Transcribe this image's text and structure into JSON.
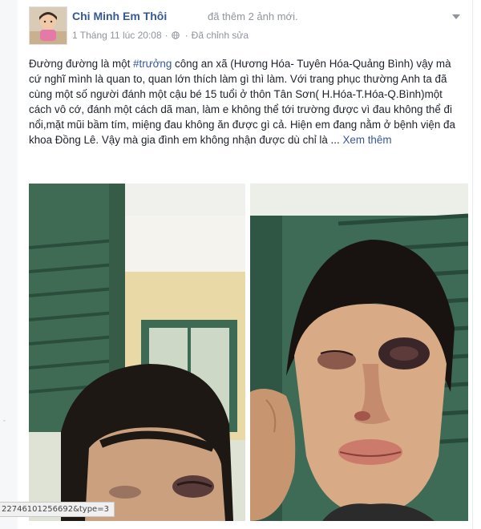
{
  "post": {
    "author": "Chi Minh Em Thôi",
    "action": "đã thêm 2 ảnh mới.",
    "timestamp": "1 Tháng 11 lúc 20:08",
    "separator": "·",
    "edited": "Đã chỉnh sửa",
    "privacy_icon": "globe-icon",
    "menu_icon": "chevron-down-icon",
    "text_before_tag": "Đường đường là một ",
    "hashtag": "#trưởng",
    "text_after_tag": " công an xã (Hương Hóa- Tuyên Hóa-Quảng Bình) vậy mà cứ nghĩ mình là quan to, quan lớn thích làm gì thì làm. Với trang phục thường Anh ta đã cùng một số người đánh một cậu bé 15 tuổi ở thôn Tân Sơn( H.Hóa-T.Hóa-Q.Bình)một cách vô cớ, đánh một cách dã man, làm e không thể tới trường được vì đau không thể đi nổi,mặt mũi bầm tím, miệng đau không ăn được gì cả. Hiện em đang nằm ở bệnh viện đa khoa Đồng Lê. Vậy mà gia đình em không nhận được dù chỉ là ...",
    "see_more": "Xem thêm"
  },
  "photos": [
    {
      "id": "photo-1"
    },
    {
      "id": "photo-2"
    }
  ],
  "status_bar": {
    "url": "22746101256692&type=3"
  },
  "colors": {
    "link": "#365899",
    "meta": "#90949c",
    "text": "#1d2129"
  }
}
